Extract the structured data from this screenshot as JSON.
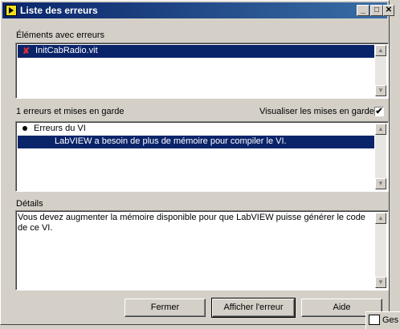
{
  "window": {
    "title": "Liste des erreurs",
    "minimize": "_",
    "maximize": "□",
    "close": "✕"
  },
  "errors_section": {
    "label": "Éléments avec erreurs",
    "items": [
      {
        "text": "InitCabRadio.vit",
        "icon": "red-x-icon"
      }
    ]
  },
  "warnings": {
    "count_label": "1 erreurs et mises en garde",
    "show_warnings_label": "Visualiser les mises en garde",
    "show_warnings_checked": "✔",
    "tree": {
      "group": "Erreurs du VI",
      "item": "LabVIEW a besoin de plus de mémoire pour compiler le VI."
    }
  },
  "details": {
    "label": "Détails",
    "text": "Vous devez augmenter la mémoire disponible pour que LabVIEW puisse générer le code de ce VI."
  },
  "buttons": {
    "close": "Fermer",
    "show_error": "Afficher l'erreur",
    "help": "Aide"
  },
  "taskbar": {
    "label": "Ges"
  },
  "scroll": {
    "up": "▲",
    "down": "▼"
  }
}
